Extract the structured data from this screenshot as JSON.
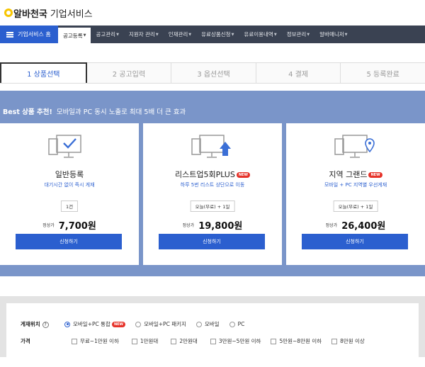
{
  "header": {
    "brand": "알바천국",
    "service": "기업서비스"
  },
  "nav": {
    "home_label": "기업서비스 홈",
    "items": [
      {
        "label": "공고등록"
      },
      {
        "label": "공고관리"
      },
      {
        "label": "지원자 관리"
      },
      {
        "label": "인재관리"
      },
      {
        "label": "유료상품신청"
      },
      {
        "label": "유료이용내역"
      },
      {
        "label": "정보관리"
      },
      {
        "label": "알바매니저"
      }
    ]
  },
  "steps": [
    {
      "label": "1 상품선택"
    },
    {
      "label": "2 공고입력"
    },
    {
      "label": "3 옵션선택"
    },
    {
      "label": "4 결제"
    },
    {
      "label": "5 등록완료"
    }
  ],
  "promo": {
    "head_bold": "Best 상품 추천!",
    "head_text": "모바일과 PC 동시 노출로 최대 5배 더 큰 효과",
    "price_label": "정상가",
    "apply_label": "신청하기",
    "badge": "NEW",
    "cards": [
      {
        "title": "일반등록",
        "desc": "대기시간 없이 즉시 게재",
        "option": "1건",
        "price": "7,700원",
        "icon": "check-monitor-icon"
      },
      {
        "title": "리스트업5회PLUS",
        "desc": "하루 5번 리스트 상단으로 이동",
        "option": "오늘(무료) + 1일",
        "price": "19,800원",
        "icon": "upload-monitor-icon"
      },
      {
        "title": "지역 그랜드",
        "desc": "모바일 + PC 지역별 우선게재",
        "option": "오늘(무료) + 1일",
        "price": "26,400원",
        "icon": "location-monitor-icon"
      }
    ]
  },
  "filter": {
    "position_label": "게재위치",
    "position_options": [
      "모바일+PC 통합",
      "모바일+PC 패키지",
      "모바일",
      "PC"
    ],
    "price_label": "가격",
    "price_options": [
      "무료~1만원 이하",
      "1만원대",
      "2만원대",
      "3만원~5만원 이하",
      "5만원~8만원 이하",
      "8만원 이상"
    ]
  },
  "colors": {
    "primary": "#2b5fcf",
    "nav_bg": "#3a4252",
    "promo_bg": "#7a95c9",
    "badge": "#e6332a"
  }
}
